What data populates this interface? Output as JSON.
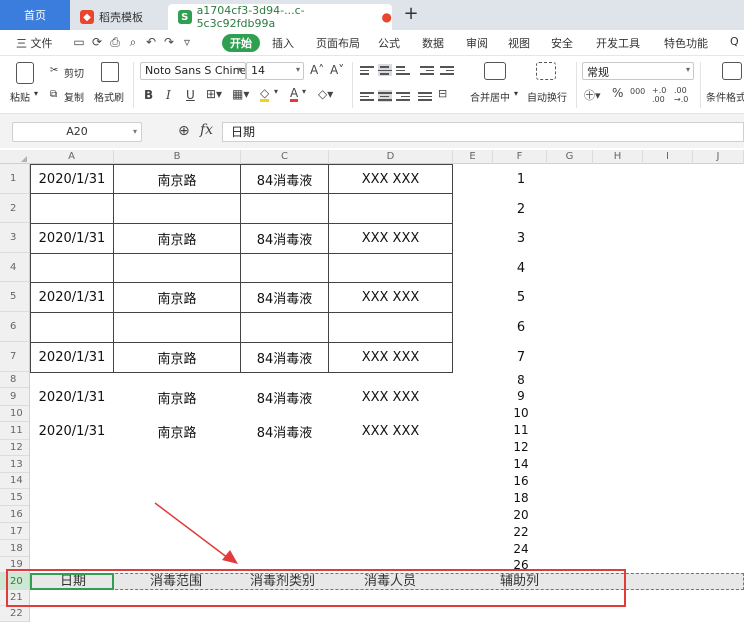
{
  "tabs": {
    "home": "首页",
    "template": "稻壳模板",
    "file": "a1704cf3-3d94-...c-5c3c92fdb99a",
    "add": "+"
  },
  "menu": {
    "file": "三 文件",
    "start": "开始",
    "insert": "插入",
    "layout": "页面布局",
    "formula": "公式",
    "data": "数据",
    "review": "审阅",
    "view": "视图",
    "security": "安全",
    "dev": "开发工具",
    "special": "特色功能",
    "search": "Q"
  },
  "ribbon": {
    "paste": "粘贴",
    "cut": "剪切",
    "copy": "复制",
    "format_painter": "格式刷",
    "font_name": "Noto Sans S Chine",
    "font_size": "14",
    "merge_center": "合并居中",
    "wrap_text": "自动换行",
    "number_format": "常规",
    "conditional": "条件格式"
  },
  "formula_bar": {
    "name_box": "A20",
    "fx": "fx",
    "content": "日期"
  },
  "columns": [
    "A",
    "B",
    "C",
    "D",
    "E",
    "F",
    "G",
    "H",
    "I",
    "J"
  ],
  "rows": [
    "1",
    "2",
    "3",
    "4",
    "5",
    "6",
    "7",
    "8",
    "9",
    "10",
    "11",
    "12",
    "13",
    "14",
    "15",
    "16",
    "17",
    "18",
    "19",
    "20",
    "21",
    "22"
  ],
  "table": [
    {
      "date": "2020/1/31",
      "road": "南京路",
      "type": "84消毒液",
      "person": "XXX XXX",
      "aux": "1"
    },
    {
      "date": "",
      "road": "",
      "type": "",
      "person": "",
      "aux": "2"
    },
    {
      "date": "2020/1/31",
      "road": "南京路",
      "type": "84消毒液",
      "person": "XXX XXX",
      "aux": "3"
    },
    {
      "date": "",
      "road": "",
      "type": "",
      "person": "",
      "aux": "4"
    },
    {
      "date": "2020/1/31",
      "road": "南京路",
      "type": "84消毒液",
      "person": "XXX XXX",
      "aux": "5"
    },
    {
      "date": "",
      "road": "",
      "type": "",
      "person": "",
      "aux": "6"
    },
    {
      "date": "2020/1/31",
      "road": "南京路",
      "type": "84消毒液",
      "person": "XXX XXX",
      "aux": "7"
    }
  ],
  "loose_rows": [
    {
      "date": "2020/1/31",
      "road": "南京路",
      "type": "84消毒液",
      "person": "XXX XXX"
    },
    {
      "date": "2020/1/31",
      "road": "南京路",
      "type": "84消毒液",
      "person": "XXX XXX"
    }
  ],
  "aux_numbers": [
    "8",
    "9",
    "10",
    "11",
    "12",
    "14",
    "16",
    "18",
    "20",
    "22",
    "24",
    "26"
  ],
  "header_row": {
    "date": "日期",
    "scope": "消毒范围",
    "type": "消毒剂类别",
    "person": "消毒人员",
    "aux": "辅助列"
  }
}
